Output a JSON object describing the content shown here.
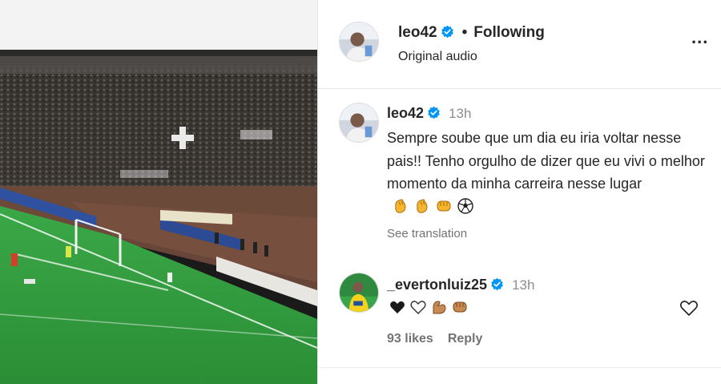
{
  "post": {
    "username": "leo42",
    "follow_status": "Following",
    "audio": "Original audio",
    "separator": "•",
    "more_label": "..."
  },
  "caption": {
    "username": "leo42",
    "timestamp": "13h",
    "text": "Sempre soube que um dia eu iria voltar nesse pais!! Tenho orgulho de dizer que eu vivi o melhor momento da minha carreira nesse lugar",
    "emojis": [
      "clapping-hands-icon",
      "clapping-hands-icon",
      "fist-bump-icon",
      "soccer-ball-icon"
    ],
    "see_translation": "See translation"
  },
  "reply": {
    "username": "_evertonluiz25",
    "timestamp": "13h",
    "emojis": [
      "black-heart-icon",
      "white-heart-icon",
      "flexed-biceps-icon",
      "fist-bump-icon"
    ],
    "likes": "93 likes",
    "reply_label": "Reply"
  },
  "colors": {
    "verified": "#0095f6",
    "text": "#262626",
    "secondary": "#737373",
    "pitch": "#2e9a3a",
    "emoji": "#f5b52e"
  }
}
